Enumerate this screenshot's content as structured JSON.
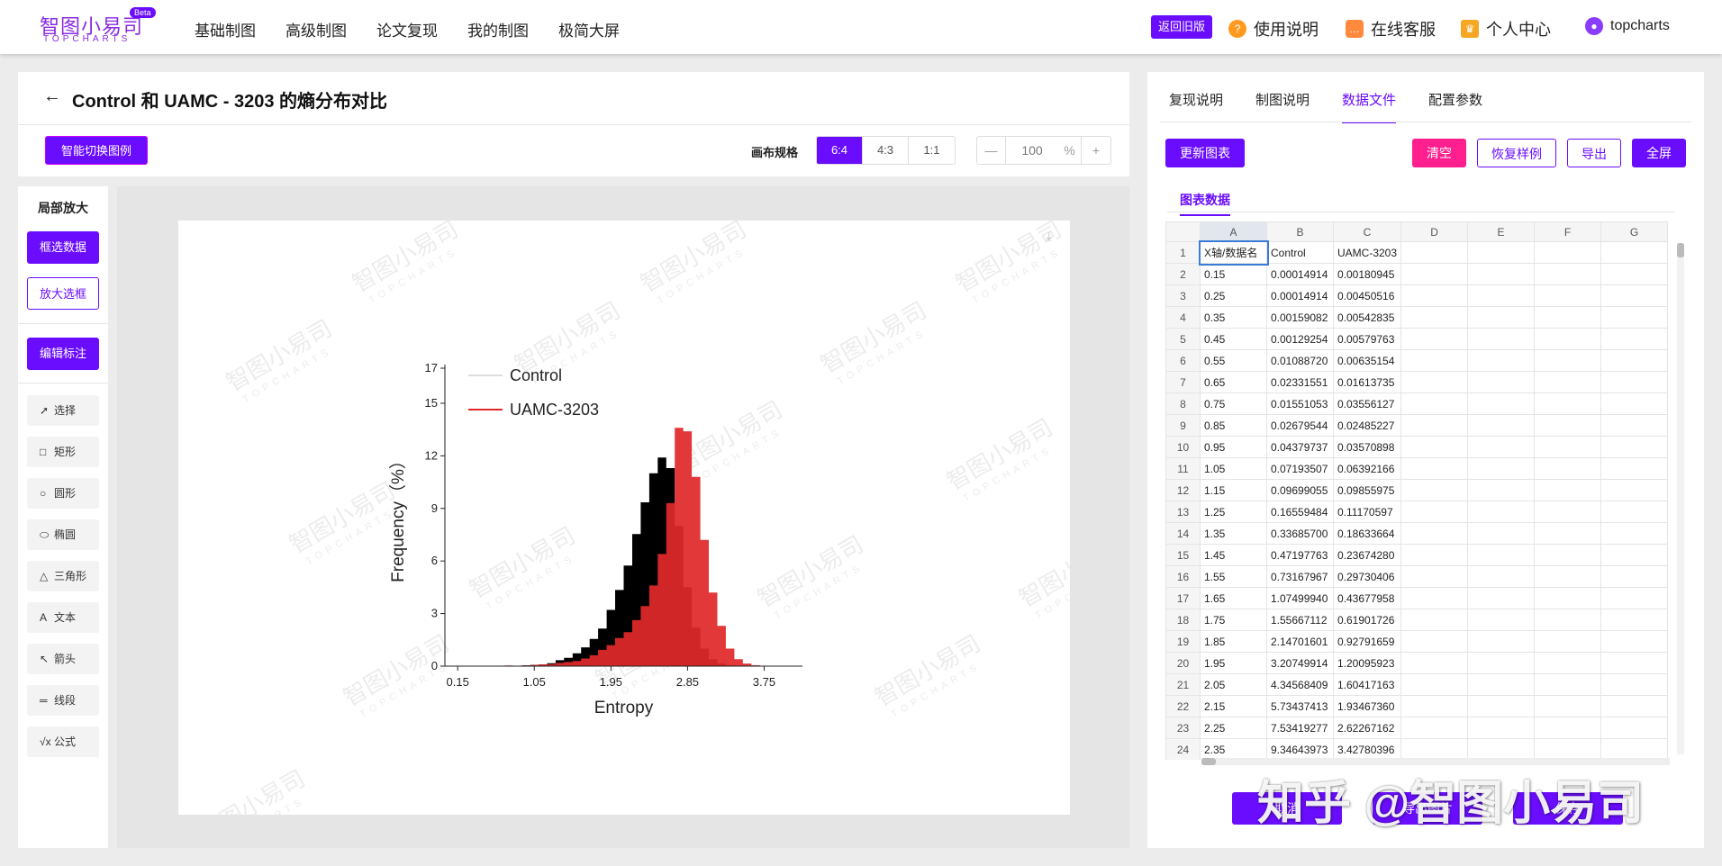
{
  "header": {
    "logo_main": "智图小易司",
    "logo_sub": "TOPCHARTS",
    "logo_badge": "Beta",
    "nav": [
      "基础制图",
      "高级制图",
      "论文复现",
      "我的制图",
      "极简大屏"
    ],
    "old_version": "返回旧版",
    "guide": "使用说明",
    "service": "在线客服",
    "personal": "个人中心",
    "user": "topcharts"
  },
  "title": "Control 和 UAMC - 3203 的熵分布对比",
  "toolbar": {
    "smart_legend": "智能切换图例",
    "canvas_label": "画布规格",
    "ratios": [
      "6:4",
      "4:3",
      "1:1"
    ],
    "active_ratio": "6:4",
    "zoom_minus": "—",
    "zoom_value": "100",
    "zoom_unit": "%",
    "zoom_plus": "+"
  },
  "sidebar": {
    "title": "局部放大",
    "select_data": "框选数据",
    "zoom_box": "放大选框",
    "edit_label": "编辑标注",
    "tools": [
      {
        "icon": "cursor-icon",
        "glyph": "➚",
        "label": "选择"
      },
      {
        "icon": "rectangle-icon",
        "glyph": "□",
        "label": "矩形"
      },
      {
        "icon": "circle-icon",
        "glyph": "○",
        "label": "圆形"
      },
      {
        "icon": "ellipse-icon",
        "glyph": "⬭",
        "label": "椭圆"
      },
      {
        "icon": "triangle-icon",
        "glyph": "△",
        "label": "三角形"
      },
      {
        "icon": "text-icon",
        "glyph": "A",
        "label": "文本"
      },
      {
        "icon": "arrow-icon",
        "glyph": "↖",
        "label": "箭头"
      },
      {
        "icon": "line-icon",
        "glyph": "═",
        "label": "线段"
      },
      {
        "icon": "formula-icon",
        "glyph": "√x",
        "label": "公式"
      }
    ]
  },
  "watermark": {
    "main": "智图小易司",
    "sub": "TOPCHARTS"
  },
  "chart_data": {
    "type": "area",
    "xlabel": "Entropy",
    "ylabel": "Frequency（%）",
    "ylim": [
      0,
      17
    ],
    "yticks": [
      0,
      3,
      6,
      9,
      12,
      15,
      17
    ],
    "xlim": [
      0,
      4.2
    ],
    "xticks": [
      "0.15",
      "1.05",
      "1.95",
      "2.85",
      "3.75"
    ],
    "x": [
      0.15,
      0.25,
      0.35,
      0.45,
      0.55,
      0.65,
      0.75,
      0.85,
      0.95,
      1.05,
      1.15,
      1.25,
      1.35,
      1.45,
      1.55,
      1.65,
      1.75,
      1.85,
      1.95,
      2.05,
      2.15,
      2.25,
      2.35,
      2.45,
      2.55,
      2.65,
      2.75,
      2.85,
      2.95,
      3.05,
      3.15,
      3.25,
      3.35,
      3.45,
      3.55,
      3.65,
      3.75
    ],
    "series": [
      {
        "name": "Control",
        "color": "#000000",
        "values": [
          0.00015,
          0.00015,
          0.0016,
          0.0013,
          0.0109,
          0.0233,
          0.0155,
          0.0268,
          0.0438,
          0.0719,
          0.097,
          0.1656,
          0.3369,
          0.472,
          0.7317,
          1.075,
          1.5567,
          2.147,
          3.2075,
          4.3457,
          5.7344,
          7.5342,
          9.3464,
          11.0,
          11.9,
          11.3,
          8.0,
          4.5,
          2.2,
          1.0,
          0.4,
          0.15,
          0.05,
          0.02,
          0.01,
          0.0,
          0.0
        ]
      },
      {
        "name": "UAMC-3203",
        "color": "#e0292a",
        "values": [
          0.0018,
          0.0045,
          0.0054,
          0.0058,
          0.0064,
          0.0161,
          0.0356,
          0.0249,
          0.0357,
          0.0639,
          0.0986,
          0.1117,
          0.1863,
          0.2367,
          0.2973,
          0.4368,
          0.619,
          0.9279,
          1.201,
          1.6042,
          1.9347,
          2.6227,
          3.4278,
          4.6,
          6.4,
          9.3,
          13.6,
          13.4,
          10.8,
          7.2,
          4.2,
          2.3,
          1.0,
          0.4,
          0.15,
          0.05,
          0.01
        ]
      }
    ],
    "legend": "top-left"
  },
  "panel": {
    "tabs": [
      "复现说明",
      "制图说明",
      "数据文件",
      "配置参数"
    ],
    "active_tab": "数据文件",
    "update_chart": "更新图表",
    "clear": "清空",
    "restore": "恢复样例",
    "export": "导出",
    "fullscreen": "全屏",
    "sub_tab": "图表数据",
    "columns": [
      "A",
      "B",
      "C",
      "D",
      "E",
      "F",
      "G"
    ],
    "rows": [
      [
        "1",
        "X轴/数据名",
        "Control",
        "UAMC-3203"
      ],
      [
        "2",
        "0.15",
        "0.00014914",
        "0.00180945"
      ],
      [
        "3",
        "0.25",
        "0.00014914",
        "0.00450516"
      ],
      [
        "4",
        "0.35",
        "0.00159082",
        "0.00542835"
      ],
      [
        "5",
        "0.45",
        "0.00129254",
        "0.00579763"
      ],
      [
        "6",
        "0.55",
        "0.01088720",
        "0.00635154"
      ],
      [
        "7",
        "0.65",
        "0.02331551",
        "0.01613735"
      ],
      [
        "8",
        "0.75",
        "0.01551053",
        "0.03556127"
      ],
      [
        "9",
        "0.85",
        "0.02679544",
        "0.02485227"
      ],
      [
        "10",
        "0.95",
        "0.04379737",
        "0.03570898"
      ],
      [
        "11",
        "1.05",
        "0.07193507",
        "0.06392166"
      ],
      [
        "12",
        "1.15",
        "0.09699055",
        "0.09855975"
      ],
      [
        "13",
        "1.25",
        "0.16559484",
        "0.11170597"
      ],
      [
        "14",
        "1.35",
        "0.33685700",
        "0.18633664"
      ],
      [
        "15",
        "1.45",
        "0.47197763",
        "0.23674280"
      ],
      [
        "16",
        "1.55",
        "0.73167967",
        "0.29730406"
      ],
      [
        "17",
        "1.65",
        "1.07499940",
        "0.43677958"
      ],
      [
        "18",
        "1.75",
        "1.55667112",
        "0.61901726"
      ],
      [
        "19",
        "1.85",
        "2.14701601",
        "0.92791659"
      ],
      [
        "20",
        "1.95",
        "3.20749914",
        "1.20095923"
      ],
      [
        "21",
        "2.05",
        "4.34568409",
        "1.60417163"
      ],
      [
        "22",
        "2.15",
        "5.73437413",
        "1.93467360"
      ],
      [
        "23",
        "2.25",
        "7.53419277",
        "2.62267162"
      ],
      [
        "24",
        "2.35",
        "9.34643973",
        "3.42780396"
      ]
    ],
    "cancel": "取消",
    "export_image": "导出图片",
    "save": "保存"
  },
  "overlay_text": "知乎 @智图小易司",
  "colors": {
    "accent": "#6a0dff",
    "pink": "#ff1f8e",
    "control": "#000000",
    "uamc": "#e0292a"
  }
}
